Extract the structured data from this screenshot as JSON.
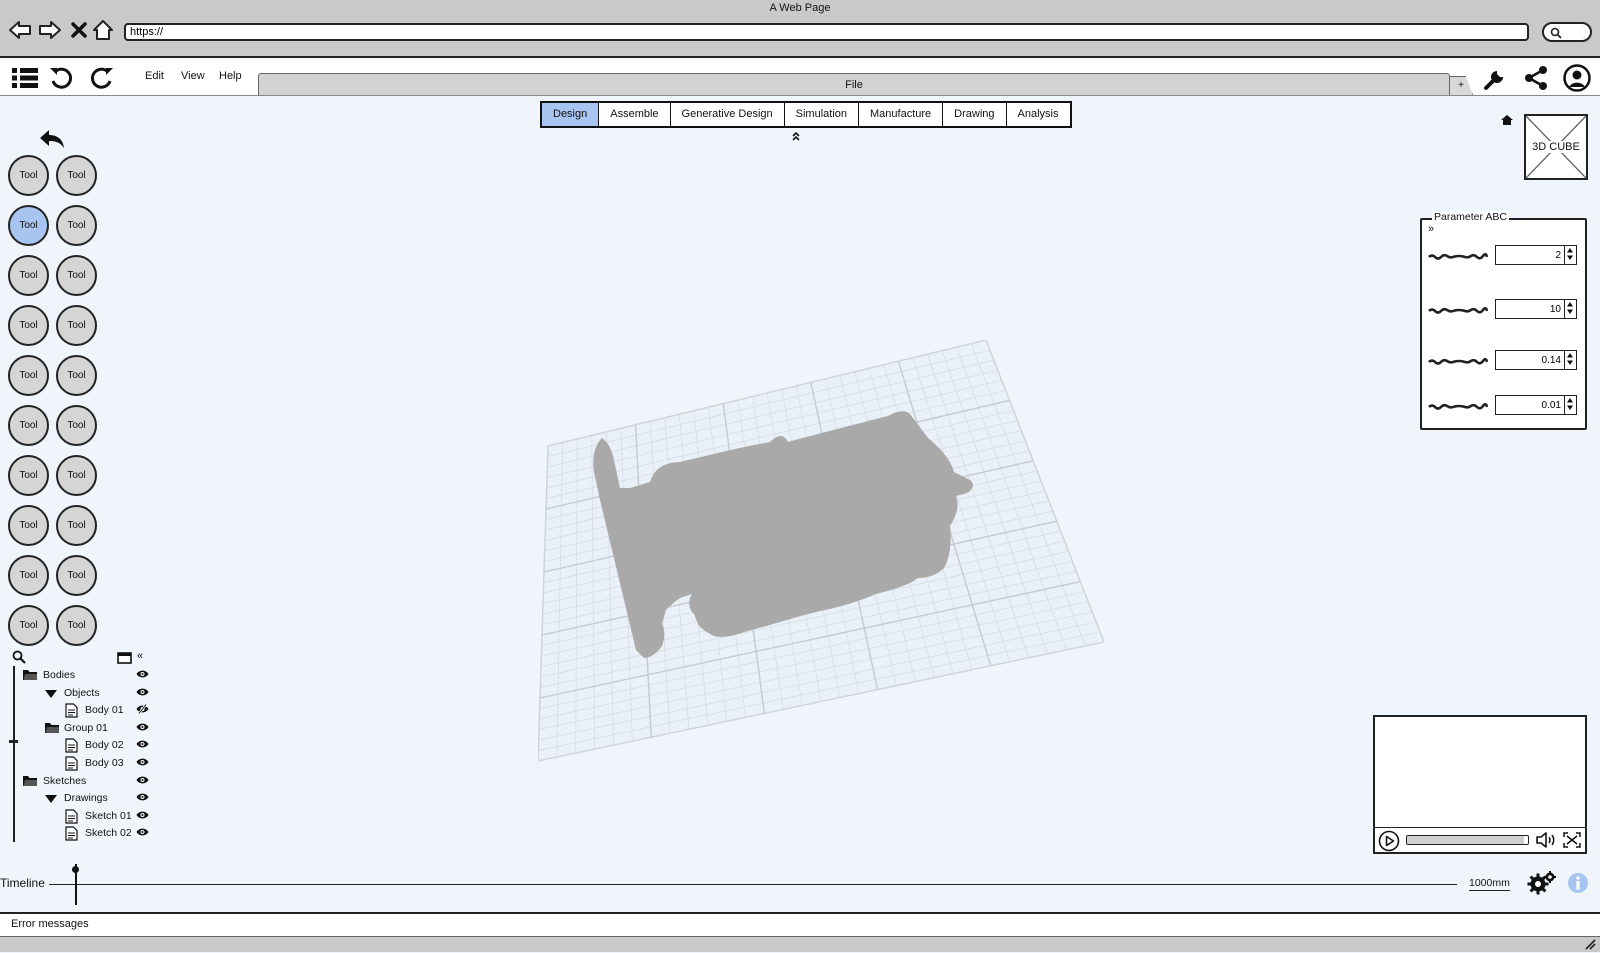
{
  "window": {
    "title": "A Web Page"
  },
  "browser": {
    "url": "https://"
  },
  "menu": {
    "items": [
      "Edit",
      "View",
      "Help"
    ]
  },
  "file_tab": {
    "label": "File",
    "new_tab_label": "+"
  },
  "workspace_tabs": {
    "items": [
      "Design",
      "Assemble",
      "Generative Design",
      "Simulation",
      "Manufacture",
      "Drawing",
      "Analysis"
    ],
    "active": "Design",
    "collapse_glyph": "«"
  },
  "tools": {
    "label": "Tool",
    "rows": 10,
    "columns": 2,
    "active_row": 2,
    "active_column": 1
  },
  "tree": {
    "collapse_glyph": "«",
    "items": [
      {
        "label": "Bodies",
        "level": 0,
        "icon": "folder-icon",
        "visible": true
      },
      {
        "label": "Objects",
        "level": 1,
        "icon": "triangle-down-icon",
        "visible": true
      },
      {
        "label": "Body 01",
        "level": 2,
        "icon": "document-icon",
        "visible": false
      },
      {
        "label": "Group 01",
        "level": 1,
        "icon": "folder-icon",
        "visible": true
      },
      {
        "label": "Body 02",
        "level": 2,
        "icon": "document-icon",
        "visible": true
      },
      {
        "label": "Body 03",
        "level": 2,
        "icon": "document-icon",
        "visible": true
      },
      {
        "label": "Sketches",
        "level": 0,
        "icon": "folder-icon",
        "visible": true
      },
      {
        "label": "Drawings",
        "level": 1,
        "icon": "triangle-down-icon",
        "visible": true
      },
      {
        "label": "Sketch 01",
        "level": 2,
        "icon": "document-icon",
        "visible": true
      },
      {
        "label": "Sketch 02",
        "level": 2,
        "icon": "document-icon",
        "visible": true
      }
    ]
  },
  "view_cube": {
    "label": "3D CUBE"
  },
  "parameters": {
    "title": "Parameter ABC",
    "expand_glyph": "»",
    "values": [
      "2",
      "10",
      "0.14",
      "0.01"
    ]
  },
  "video": {
    "progress": 0.97
  },
  "timeline": {
    "label": "Timeline",
    "scale": "1000mm"
  },
  "status": {
    "message": "Error messages"
  },
  "colors": {
    "accent": "#a8c4f0",
    "model": "#a9a9a9",
    "grid": "#d6dae0",
    "background": "#f0f5fc"
  }
}
